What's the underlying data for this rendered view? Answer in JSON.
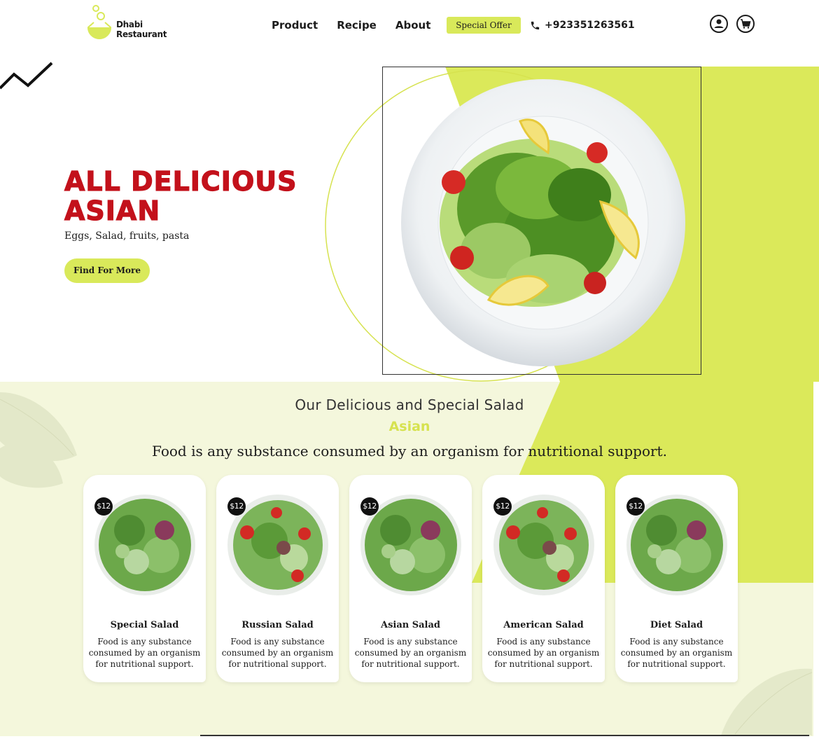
{
  "brand": {
    "name": "Dhabi Restaurant"
  },
  "nav": {
    "items": [
      "Product",
      "Recipe",
      "About"
    ]
  },
  "header": {
    "offer_label": "Special Offer",
    "phone": "+923351263561",
    "icons": [
      "phone-icon",
      "user-icon",
      "cart-icon"
    ]
  },
  "hero": {
    "title": "ALL DELICIOUS ASIAN",
    "subtitle": "Eggs, Salad, fruits, pasta",
    "cta_label": "Find For More"
  },
  "section": {
    "subtitle": "Our Delicious and Special Salad",
    "accent": "Asian",
    "description": "Food is any substance consumed by an organism for nutritional support."
  },
  "cards": [
    {
      "title": "Special Salad",
      "price": "$12",
      "text": "Food is any substance consumed by an organism for nutritional support."
    },
    {
      "title": "Russian Salad",
      "price": "$12",
      "text": "Food is any substance consumed by an organism for nutritional support."
    },
    {
      "title": "Asian Salad",
      "price": "$12",
      "text": "Food is any substance consumed by an organism for nutritional support."
    },
    {
      "title": "American Salad",
      "price": "$12",
      "text": "Food is any substance consumed by an organism for nutritional support."
    },
    {
      "title": "Diet Salad",
      "price": "$12",
      "text": "Food is any substance consumed by an organism for nutritional support."
    }
  ],
  "colors": {
    "accent_green": "#d9e95a",
    "title_red": "#c3111b",
    "section_bg": "#f4f7dc"
  }
}
